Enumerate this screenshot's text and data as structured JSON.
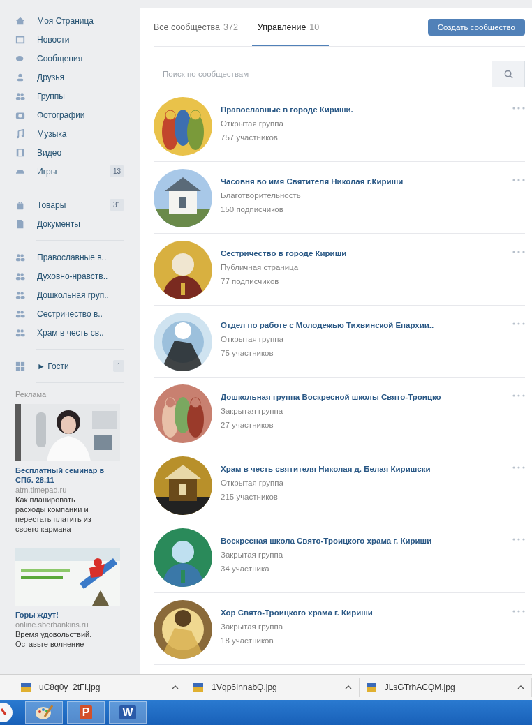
{
  "sidebar": {
    "sections": [
      [
        {
          "label": "Моя Страница"
        },
        {
          "label": "Новости"
        },
        {
          "label": "Сообщения"
        },
        {
          "label": "Друзья"
        },
        {
          "label": "Группы"
        },
        {
          "label": "Фотографии"
        },
        {
          "label": "Музыка"
        },
        {
          "label": "Видео"
        },
        {
          "label": "Игры",
          "count": "13"
        }
      ],
      [
        {
          "label": "Товары",
          "count": "31"
        },
        {
          "label": "Документы"
        }
      ],
      [
        {
          "label": "Православные в.."
        },
        {
          "label": "Духовно-нравств.."
        },
        {
          "label": "Дошкольная груп.."
        },
        {
          "label": "Сестричество в.."
        },
        {
          "label": "Храм в честь св.."
        }
      ],
      [
        {
          "label": "► Гости",
          "count": "1"
        }
      ]
    ],
    "ads_heading": "Реклама",
    "ads": [
      {
        "title": "Бесплатный семинар в СПб. 28.11",
        "site": "atm.timepad.ru",
        "text": "Как планировать расходы компании и перестать платить из своего кармана"
      },
      {
        "title": "Горы ждут!",
        "site": "online.sberbankins.ru",
        "text": "Время удовольствий. Оставьте волнение"
      }
    ]
  },
  "tabs": [
    {
      "label": "Все сообщества",
      "count": "372",
      "selected": false
    },
    {
      "label": "Управление",
      "count": "10",
      "selected": true
    }
  ],
  "create_button": "Создать сообщество",
  "search": {
    "placeholder": "Поиск по сообществам"
  },
  "communities": [
    {
      "name": "Православные в городе Кириши.",
      "type": "Открытая группа",
      "members": "757 участников"
    },
    {
      "name": "Часовня во имя Святителя Николая г.Кириши",
      "type": "Благотворительность",
      "members": "150 подписчиков"
    },
    {
      "name": "Сестричество в городе Кириши",
      "type": "Публичная страница",
      "members": "77 подписчиков"
    },
    {
      "name": "Отдел по работе с Молодежью Тихвинской Епархии..",
      "type": "Открытая группа",
      "members": "75 участников"
    },
    {
      "name": "Дошкольная группа Воскресной школы Свято-Троицко",
      "type": "Закрытая группа",
      "members": "27 участников"
    },
    {
      "name": "Храм в честь святителя Николая д. Белая Киришски",
      "type": "Открытая группа",
      "members": "215 участников"
    },
    {
      "name": "Воскресная школа Свято-Троицкого храма г. Кириши",
      "type": "Закрытая группа",
      "members": "34 участника"
    },
    {
      "name": "Хор Свято-Троицкого храма г. Кириши",
      "type": "Закрытая группа",
      "members": "18 участников"
    }
  ],
  "downloads": [
    {
      "file": "uC8q0y_2tFl.jpg"
    },
    {
      "file": "1Vqp6InnabQ.jpg"
    },
    {
      "file": "JLsGTrhACQM.jpg"
    }
  ],
  "taskbar": [
    {
      "kind": "paint"
    },
    {
      "kind": "powerpoint",
      "letter": "P"
    },
    {
      "kind": "word",
      "letter": "W"
    }
  ]
}
